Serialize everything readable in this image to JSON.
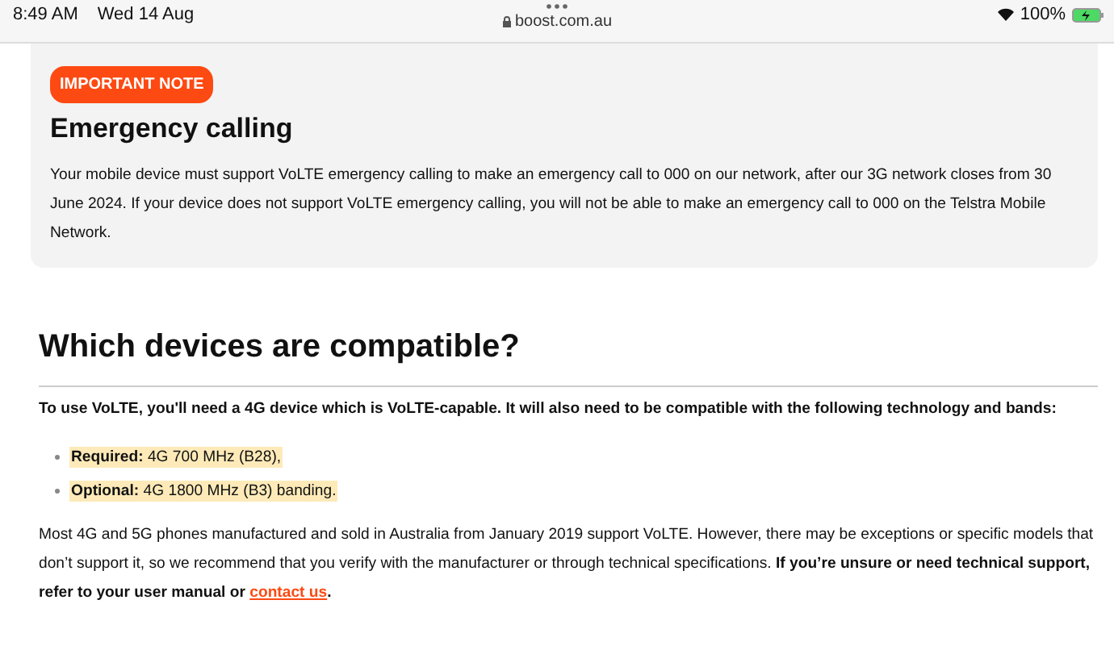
{
  "status_bar": {
    "time": "8:49 AM",
    "date": "Wed 14 Aug",
    "url": "boost.com.au",
    "battery": "100%"
  },
  "note": {
    "badge": "IMPORTANT NOTE",
    "title": "Emergency calling",
    "body": "Your mobile device must support VoLTE emergency calling to make an emergency call to 000 on our network, after our 3G network closes from 30 June 2024. If your device does not support VoLTE emergency calling, you will not be able to make an emergency call to 000 on the Telstra Mobile Network."
  },
  "section": {
    "heading": "Which devices are compatible?",
    "intro": "To use VoLTE, you'll need a 4G device which is VoLTE-capable. It will also need to be compatible with the following technology and bands:",
    "bullets": [
      "**Required:** 4G 700 MHz (B28),",
      "**Optional:** 4G 1800 MHz (B3) banding."
    ],
    "paragraph": {
      "text": "Most 4G and 5G phones manufactured and sold in Australia from January 2019 support VoLTE. However, there may be exceptions or specific models that don’t support it, so we recommend that you verify with the manufacturer or through technical specifications.  **If you’re unsure or need technical support, refer to your user manual or** ",
      "link": "contact us",
      "after": "."
    }
  }
}
